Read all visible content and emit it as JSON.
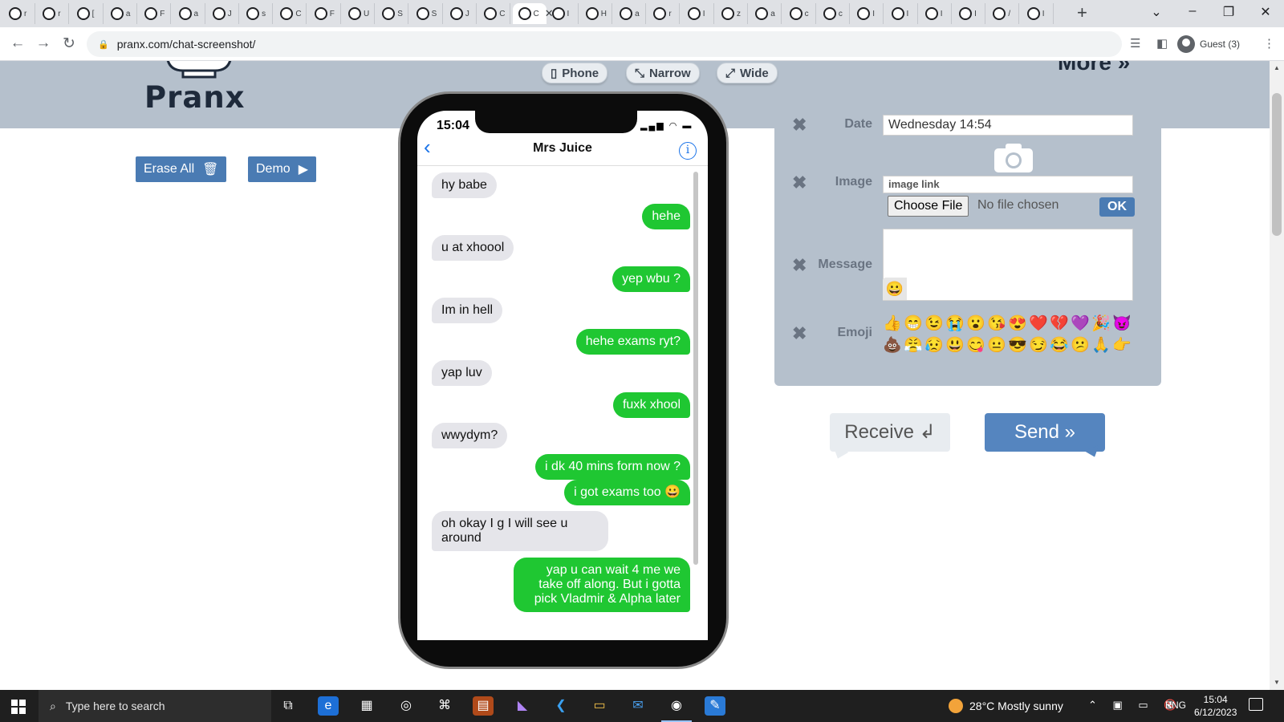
{
  "browser": {
    "tabs": [
      {
        "letter": "r"
      },
      {
        "letter": "r"
      },
      {
        "letter": "["
      },
      {
        "letter": "a"
      },
      {
        "letter": "F"
      },
      {
        "letter": "a"
      },
      {
        "letter": "J"
      },
      {
        "letter": "s"
      },
      {
        "letter": "C"
      },
      {
        "letter": "F"
      },
      {
        "letter": "U"
      },
      {
        "letter": "S"
      },
      {
        "letter": "S"
      },
      {
        "letter": "J"
      },
      {
        "letter": "C"
      },
      {
        "letter": "C",
        "active": true
      },
      {
        "letter": "I"
      },
      {
        "letter": "H"
      },
      {
        "letter": "a"
      },
      {
        "letter": "r"
      },
      {
        "letter": "I"
      },
      {
        "letter": "z"
      },
      {
        "letter": "a"
      },
      {
        "letter": "c"
      },
      {
        "letter": "c"
      },
      {
        "letter": "I"
      },
      {
        "letter": "I"
      },
      {
        "letter": "I"
      },
      {
        "letter": "I"
      },
      {
        "letter": "/"
      },
      {
        "letter": "I"
      }
    ],
    "new_tab": "+",
    "url": "pranx.com/chat-screenshot/",
    "profile": "Guest (3)"
  },
  "site": {
    "logo": "Pranx",
    "more": "More »",
    "view_buttons": [
      "Phone",
      "Narrow",
      "Wide"
    ],
    "erase_all": "Erase All",
    "demo": "Demo"
  },
  "phone": {
    "time": "15:04",
    "contact": "Mrs Juice",
    "messages": [
      {
        "dir": "in",
        "text": "hy babe"
      },
      {
        "dir": "out",
        "text": "hehe"
      },
      {
        "dir": "in",
        "text": "u at xhoool"
      },
      {
        "dir": "out",
        "text": "yep wbu ?"
      },
      {
        "dir": "in",
        "text": "Im in hell"
      },
      {
        "dir": "out",
        "text": "hehe exams ryt?"
      },
      {
        "dir": "in",
        "text": "yap luv"
      },
      {
        "dir": "out",
        "text": "fuxk xhool"
      },
      {
        "dir": "in",
        "text": "wwydym?"
      },
      {
        "dir": "out",
        "text": "i dk 40 mins form now ?"
      },
      {
        "dir": "out",
        "text": "i got exams too 😀"
      },
      {
        "dir": "in",
        "text": "oh okay I g I will see u around"
      },
      {
        "dir": "out",
        "text": "yap u can wait 4 me we take off along. But i gotta pick Vladmir & Alpha later"
      }
    ]
  },
  "form": {
    "date_label": "Date",
    "date_value": "Wednesday 14:54",
    "image_label": "Image",
    "image_link_placeholder": "image link",
    "choose_file": "Choose File",
    "no_file": "No file chosen",
    "ok": "OK",
    "message_label": "Message",
    "message_emoji": "😀",
    "emoji_label": "Emoji",
    "emojis": [
      "👍",
      "😁",
      "😉",
      "😭",
      "😮",
      "😘",
      "😍",
      "❤️",
      "💔",
      "💜",
      "🎉",
      "😈",
      "💩",
      "😤",
      "😥",
      "😃",
      "😋",
      "😐",
      "😎",
      "😏",
      "😂",
      "😕",
      "🙏",
      "👉"
    ]
  },
  "actions": {
    "receive": "Receive ↲",
    "send": "Send »"
  },
  "taskbar": {
    "search_placeholder": "Type here to search",
    "weather": "28°C  Mostly sunny",
    "lang": "ENG",
    "time": "15:04",
    "date": "6/12/2023"
  }
}
